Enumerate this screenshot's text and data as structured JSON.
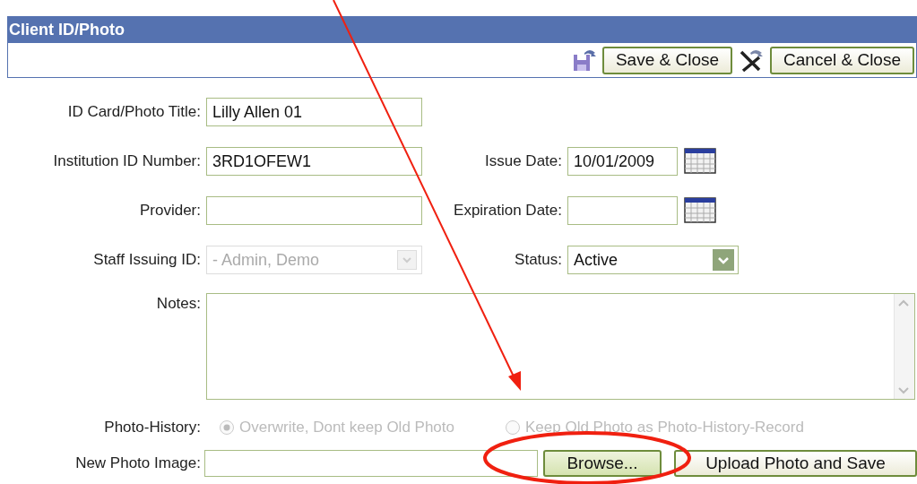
{
  "window": {
    "title": "Client ID/Photo"
  },
  "toolbar": {
    "buttons": [
      {
        "kind": "save",
        "label": "Save & Close"
      },
      {
        "kind": "cancel",
        "label": "Cancel & Close"
      }
    ]
  },
  "form": {
    "rows": [
      {
        "fields": [
          {
            "kind": "text",
            "label": "ID Card/Photo Title:",
            "value": "Lilly Allen 01"
          }
        ]
      },
      {
        "fields": [
          {
            "kind": "text",
            "label": "Institution ID Number:",
            "value": "3RD1OFEW1"
          },
          {
            "kind": "date",
            "label": "Issue Date:",
            "value": "10/01/2009"
          }
        ]
      },
      {
        "fields": [
          {
            "kind": "text",
            "label": "Provider:"
          },
          {
            "kind": "date",
            "label": "Expiration Date:"
          }
        ]
      },
      {
        "fields": [
          {
            "kind": "select",
            "label": "Staff Issuing ID:",
            "value": "- Admin, Demo",
            "disabled": true
          },
          {
            "kind": "select",
            "label": "Status:",
            "value": "Active",
            "disabled": false
          }
        ]
      }
    ],
    "notes": {
      "label": "Notes:"
    },
    "photo_history": {
      "label": "Photo-History:",
      "options": [
        {
          "label": "Overwrite, Dont keep Old Photo",
          "selected": true,
          "disabled": true
        },
        {
          "label": "Keep Old Photo as Photo-History-Record",
          "selected": false,
          "disabled": true
        }
      ]
    },
    "new_photo": {
      "label": "New Photo Image:",
      "browse": "Browse...",
      "upload": "Upload Photo and Save"
    }
  }
}
